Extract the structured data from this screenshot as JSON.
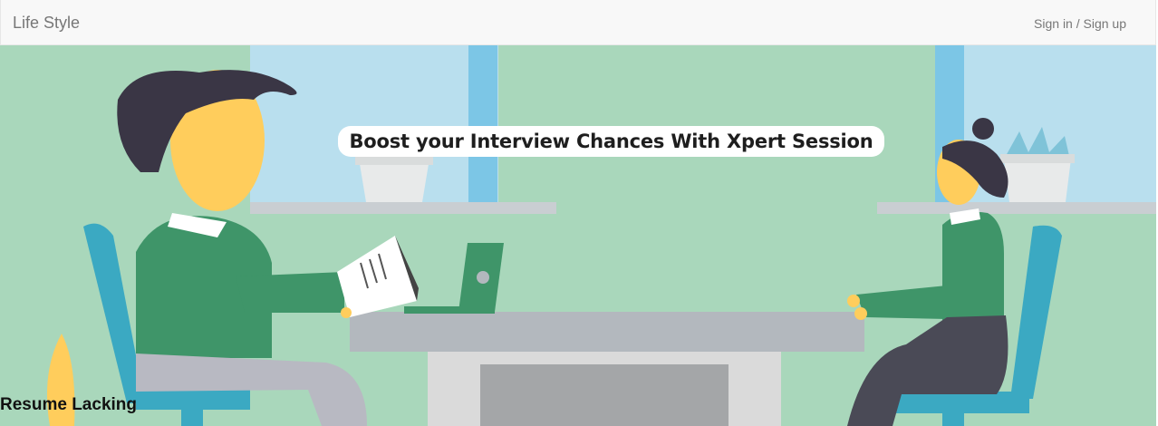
{
  "navbar": {
    "brand": "Life Style",
    "auth_link": "Sign in / Sign up"
  },
  "hero": {
    "banner_text": "Boost your Interview Chances With Xpert Session",
    "colors": {
      "wall": "#a9d7bb",
      "window": "#b9dfee",
      "skin": "#ffcd5c",
      "shirt": "#3f9569",
      "chair": "#3ba9c2",
      "table": "#b3b8be",
      "hair": "#3a3645"
    }
  },
  "section": {
    "title": "Resume Lacking"
  }
}
